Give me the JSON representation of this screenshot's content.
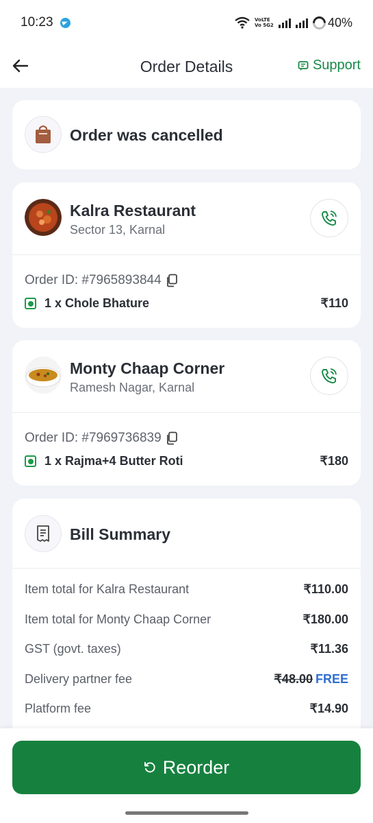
{
  "status_bar": {
    "time": "10:23",
    "network_label": "VoLTE Vo 5G2",
    "battery": "40%"
  },
  "header": {
    "title": "Order Details",
    "support_label": "Support"
  },
  "status_card": {
    "text": "Order was cancelled"
  },
  "orders": [
    {
      "restaurant": "Kalra Restaurant",
      "location": "Sector 13, Karnal",
      "order_id": "Order ID: #7965893844",
      "item": "1 x Chole Bhature",
      "price": "₹110"
    },
    {
      "restaurant": "Monty Chaap Corner",
      "location": "Ramesh Nagar, Karnal",
      "order_id": "Order ID: #7969736839",
      "item": "1 x Rajma+4 Butter Roti",
      "price": "₹180"
    }
  ],
  "bill": {
    "title": "Bill Summary",
    "rows": [
      {
        "label": "Item total for Kalra Restaurant",
        "value": "₹110.00"
      },
      {
        "label": "Item total for Monty Chaap Corner",
        "value": "₹180.00"
      },
      {
        "label": "GST (govt. taxes)",
        "value": "₹11.36"
      },
      {
        "label": "Delivery partner fee",
        "value_strike": "₹48.00",
        "value_free": "FREE"
      },
      {
        "label": "Platform fee",
        "value": "₹14.90"
      }
    ]
  },
  "reorder_label": "Reorder",
  "colors": {
    "accent": "#16813f",
    "free": "#2f6fd1"
  }
}
